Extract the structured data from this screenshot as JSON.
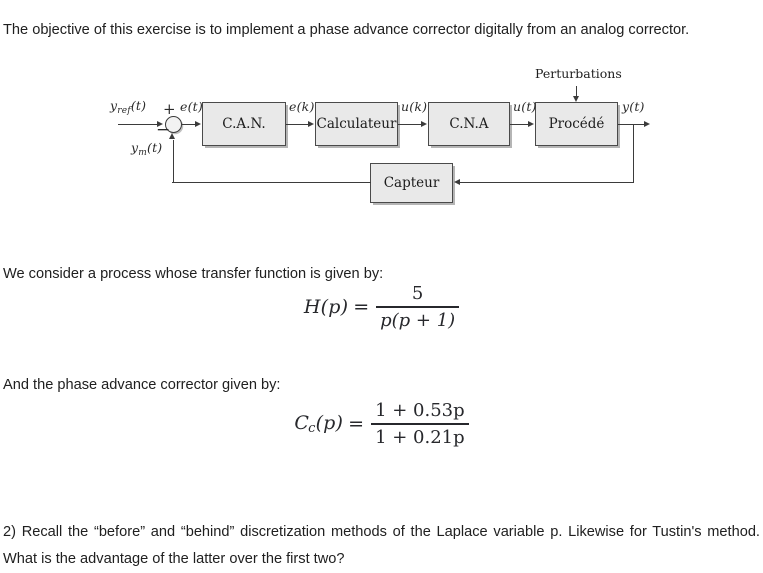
{
  "document": {
    "intro_paragraph": "The objective of this exercise is to implement a phase advance corrector digitally from an analog corrector.",
    "process_intro": "We consider a process whose transfer function is given by:",
    "corrector_intro": "And the phase advance corrector given by:",
    "question_paragraph": "2) Recall the “before” and “behind” discretization methods of the Laplace variable p. Likewise for Tustin's method. What is the advantage of the latter over the first two?"
  },
  "equations": {
    "transfer_function": {
      "lhs": "H",
      "lhs_arg": "(p)",
      "equals": "=",
      "numerator": "5",
      "denominator": "p(p + 1)",
      "plain": "H(p) = 5 / (p(p+1))"
    },
    "corrector": {
      "lhs": "C",
      "lhs_sub": "c",
      "lhs_arg": "(p)",
      "equals": "=",
      "numerator": "1 + 0.53p",
      "denominator": "1 + 0.21p",
      "plain": "Cc(p) = (1 + 0.53p) / (1 + 0.21p)"
    }
  },
  "diagram": {
    "title": "digital control loop block diagram",
    "blocks": [
      {
        "id": "can",
        "label": "C.A.N."
      },
      {
        "id": "calculateur",
        "label": "Calculateur"
      },
      {
        "id": "cna",
        "label": "C.N.A"
      },
      {
        "id": "procede",
        "label": "Procédé"
      },
      {
        "id": "capteur",
        "label": "Capteur"
      }
    ],
    "signals": {
      "reference": "y",
      "reference_sub": "ref",
      "reference_arg": "(t)",
      "error_continuous": "e(t)",
      "measured": "y",
      "measured_sub": "m",
      "measured_arg": "(t)",
      "error_sampled": "e(k)",
      "command_sampled": "u(k)",
      "command_continuous": "u(t)",
      "output": "y(t)"
    },
    "summing_junction": {
      "plus_sign": "+",
      "minus_sign": "−"
    },
    "disturbance_label": "Perturbations",
    "colors": {
      "block_fill": "#e9e9e9",
      "block_border": "#4a4a4a",
      "wire": "#3b3b3b",
      "text": "#1c1c1c"
    }
  }
}
